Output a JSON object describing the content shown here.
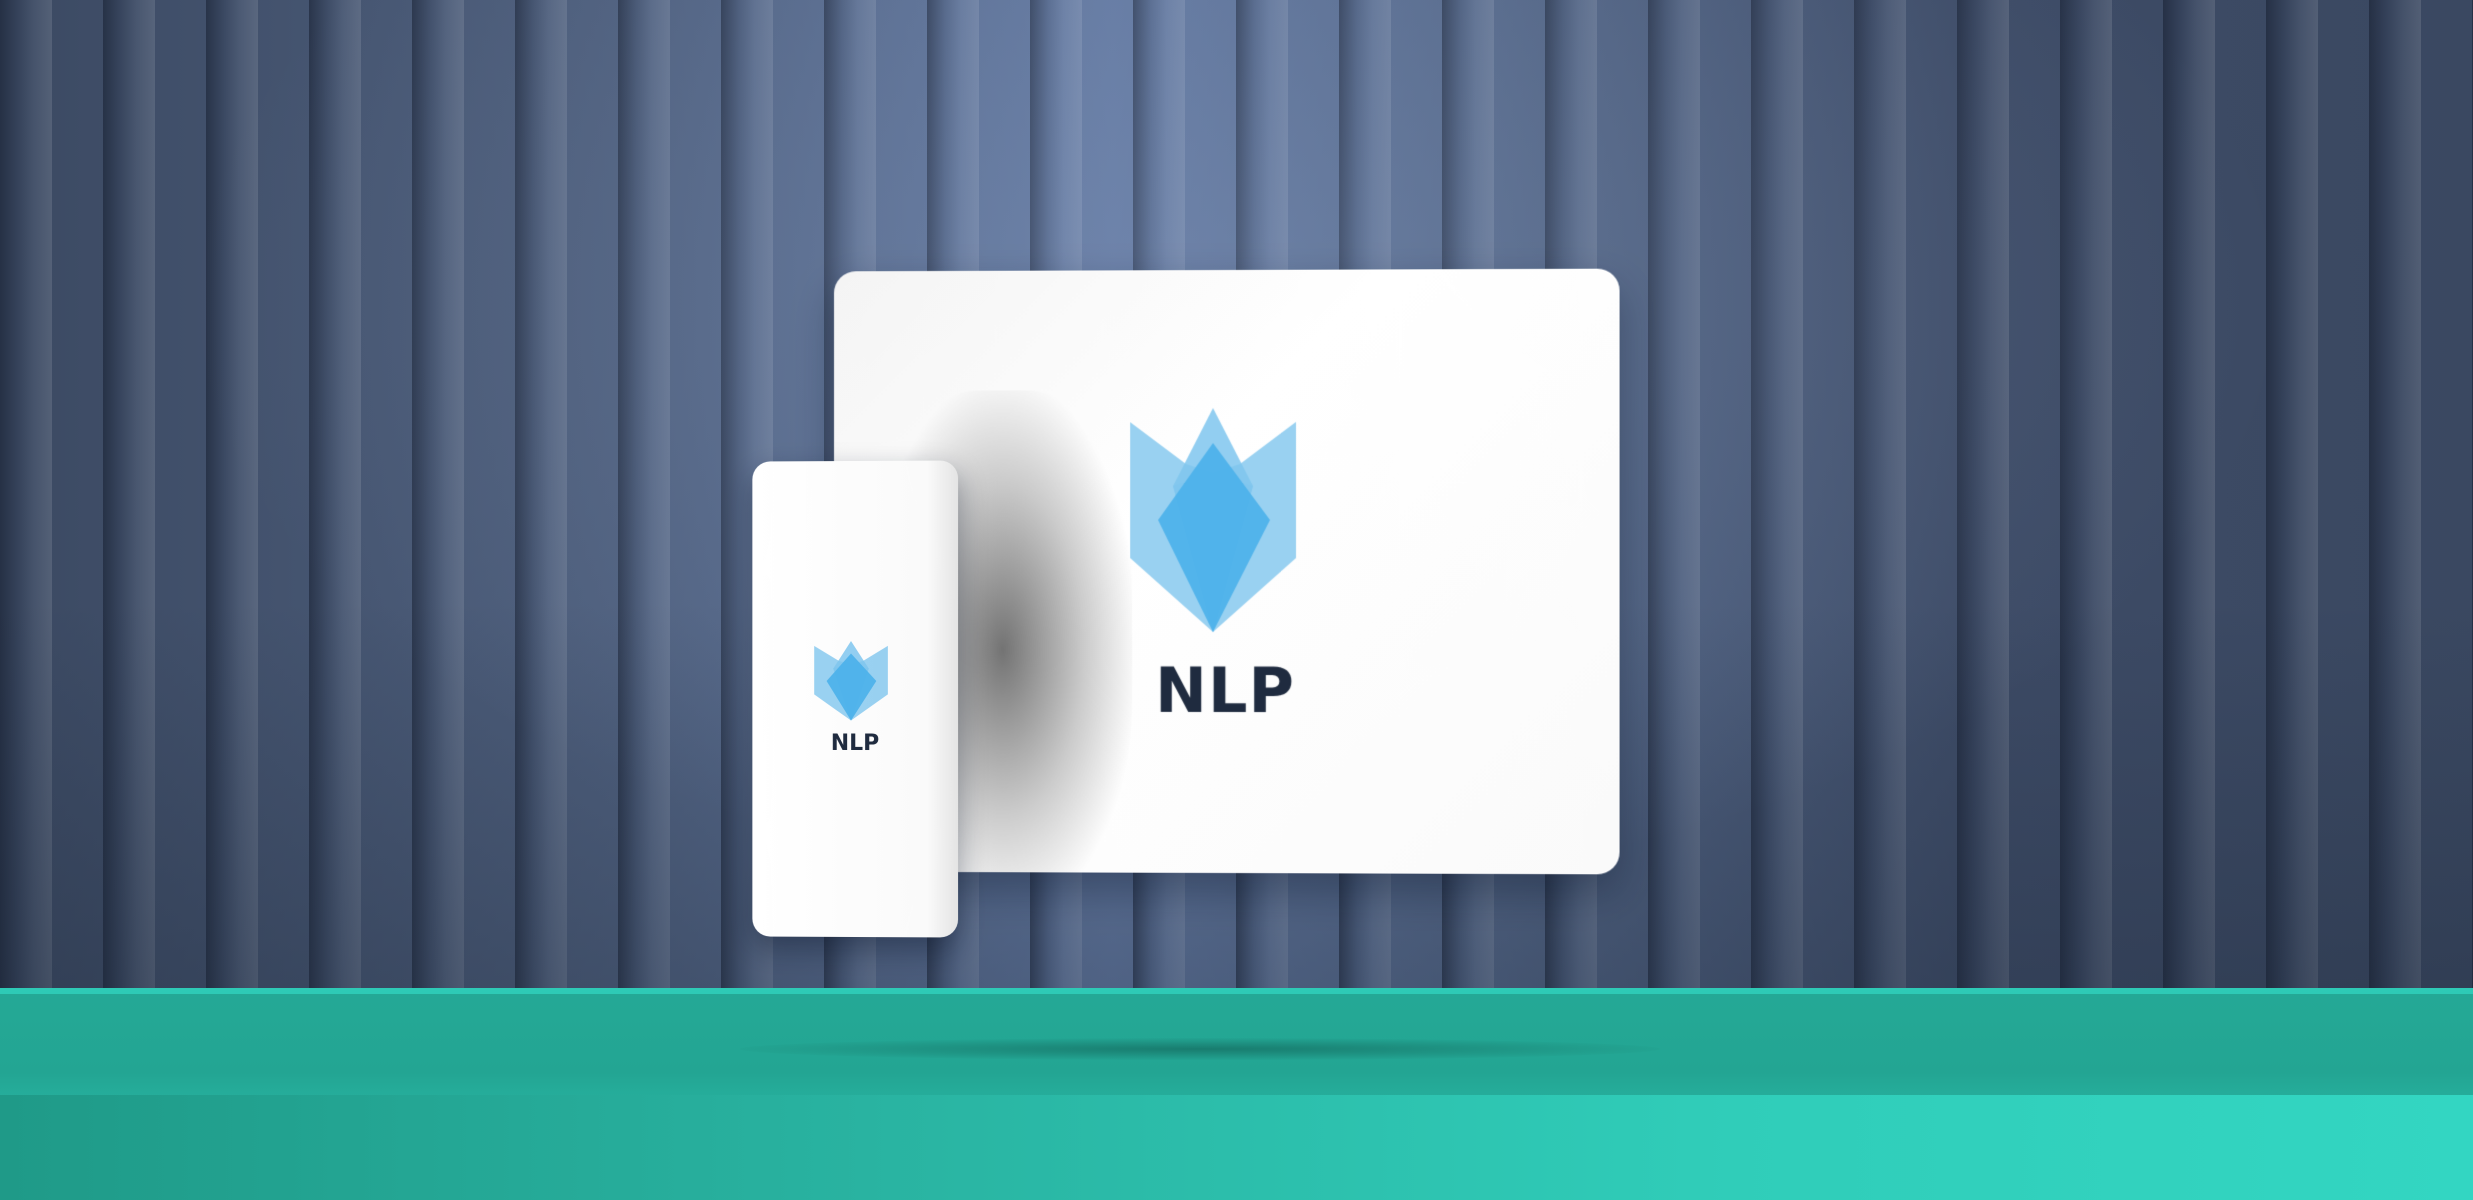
{
  "scene": {
    "description_icons": [
      "nlp-flame-logo-icon"
    ],
    "colors": {
      "wall": "#4e5f7d",
      "floor": "#2bbfac",
      "logo_blue": "#4ab0ea",
      "logo_light_blue": "#7fc6ee",
      "text": "#1f2b3f"
    }
  },
  "tablet": {
    "brand_text": "NLP"
  },
  "phone": {
    "brand_text": "NLP"
  }
}
